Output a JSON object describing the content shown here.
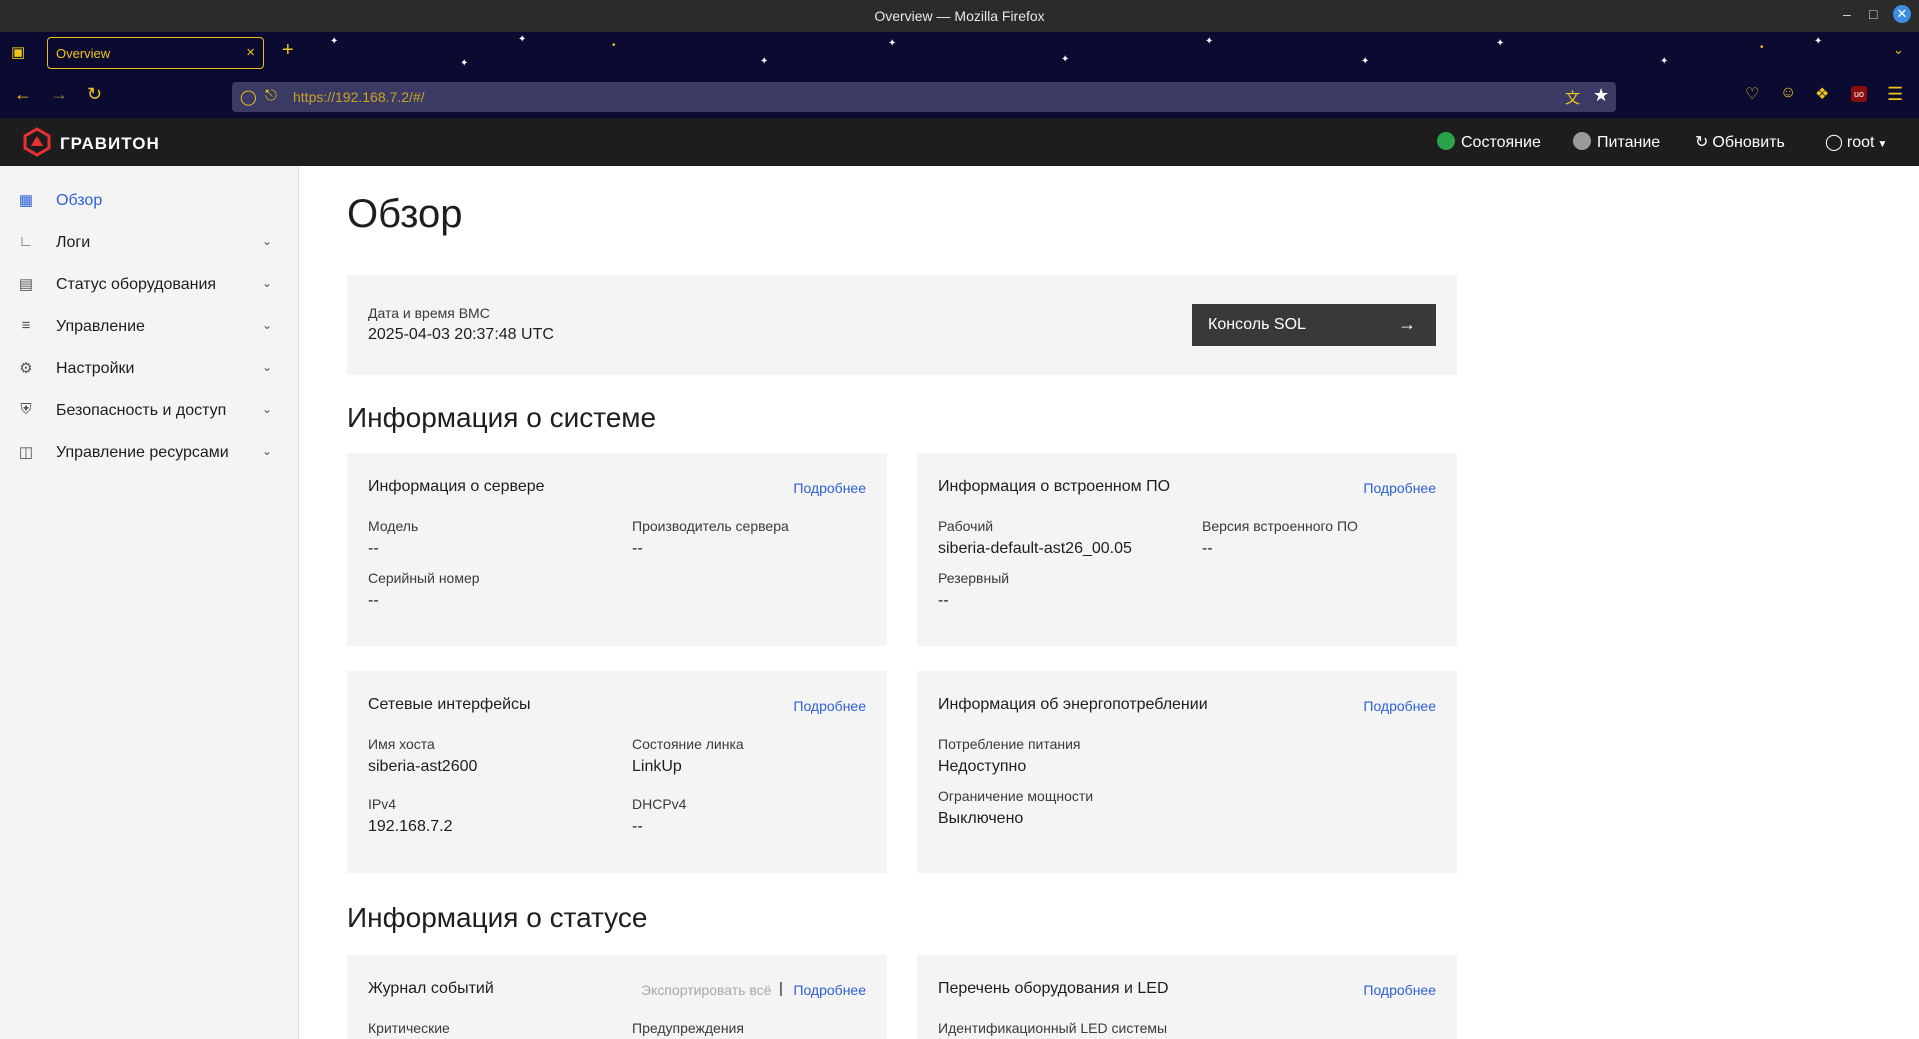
{
  "window": {
    "title": "Overview — Mozilla Firefox"
  },
  "browser": {
    "tab_label": "Overview",
    "url": "https://192.168.7.2/#/"
  },
  "header": {
    "brand": "ГРАВИТОН",
    "status_label": "Состояние",
    "power_label": "Питание",
    "refresh_label": "Обновить",
    "user_label": "root"
  },
  "sidebar": {
    "items": [
      {
        "label": "Обзор",
        "icon": "dashboard-icon"
      },
      {
        "label": "Логи",
        "icon": "chart-icon"
      },
      {
        "label": "Статус оборудования",
        "icon": "server-icon"
      },
      {
        "label": "Управление",
        "icon": "sliders-icon"
      },
      {
        "label": "Настройки",
        "icon": "gear-icon"
      },
      {
        "label": "Безопасность и доступ",
        "icon": "shield-icon"
      },
      {
        "label": "Управление ресурсами",
        "icon": "resources-icon"
      }
    ]
  },
  "main": {
    "title": "Обзор",
    "bmc": {
      "label": "Дата и время BMC",
      "value": "2025-04-03 20:37:48 UTC",
      "sol_button": "Консоль SOL"
    },
    "system_info_title": "Информация о системе",
    "server_card": {
      "title": "Информация о сервере",
      "more": "Подробнее",
      "model_label": "Модель",
      "model_value": "--",
      "vendor_label": "Производитель сервера",
      "vendor_value": "--",
      "serial_label": "Серийный номер",
      "serial_value": "--"
    },
    "firmware_card": {
      "title": "Информация о встроенном ПО",
      "more": "Подробнее",
      "running_label": "Рабочий",
      "running_value": "siberia-default-ast26_00.05",
      "version_label": "Версия встроенного ПО",
      "version_value": "--",
      "backup_label": "Резервный",
      "backup_value": "--"
    },
    "network_card": {
      "title": "Сетевые интерфейсы",
      "more": "Подробнее",
      "hostname_label": "Имя хоста",
      "hostname_value": "siberia-ast2600",
      "link_label": "Состояние линка",
      "link_value": "LinkUp",
      "ipv4_label": "IPv4",
      "ipv4_value": "192.168.7.2",
      "dhcp_label": "DHCPv4",
      "dhcp_value": "--"
    },
    "power_card": {
      "title": "Информация об энергопотреблении",
      "more": "Подробнее",
      "consumption_label": "Потребление питания",
      "consumption_value": "Недоступно",
      "cap_label": "Ограничение мощности",
      "cap_value": "Выключено"
    },
    "status_info_title": "Информация о статусе",
    "events_card": {
      "title": "Журнал событий",
      "export": "Экспортировать всё",
      "more": "Подробнее",
      "critical_label": "Критические",
      "warnings_label": "Предупреждения"
    },
    "inventory_card": {
      "title": "Перечень оборудования и LED",
      "more": "Подробнее",
      "led_label": "Идентификационный LED системы"
    }
  }
}
